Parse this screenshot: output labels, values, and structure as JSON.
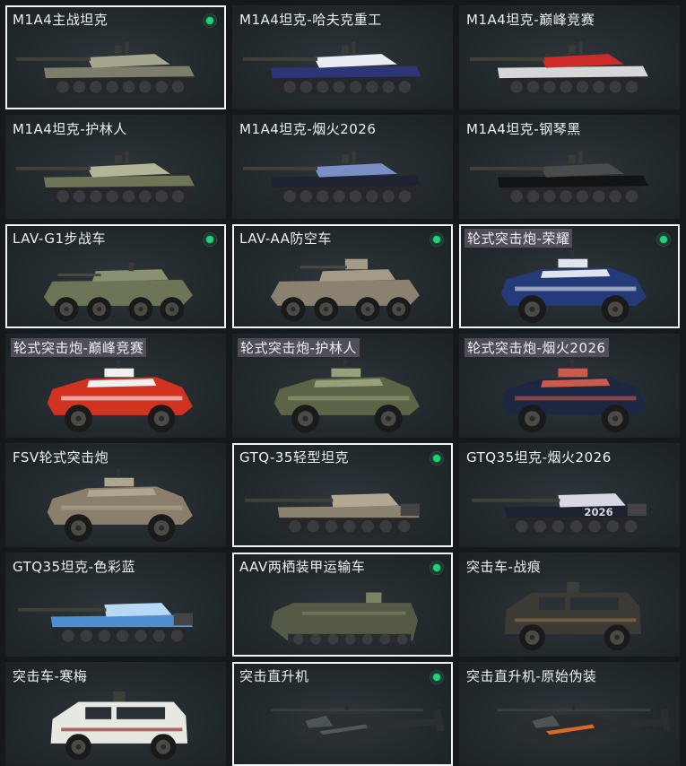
{
  "vehicles": [
    {
      "name": "M1A4主战坦克",
      "type": "tank",
      "body": "#7c7d6a",
      "accent": "#a6a58d",
      "selected": true,
      "equipped": true
    },
    {
      "name": "M1A4坦克-哈夫克重工",
      "type": "tank",
      "body": "#2d3577",
      "accent": "#e9ecf5",
      "selected": false,
      "equipped": false
    },
    {
      "name": "M1A4坦克-巅峰竞赛",
      "type": "tank",
      "body": "#d7d7d7",
      "accent": "#cf2a2a",
      "selected": false,
      "equipped": false
    },
    {
      "name": "M1A4坦克-护林人",
      "type": "tank",
      "body": "#6f7556",
      "accent": "#b3b597",
      "selected": false,
      "equipped": false
    },
    {
      "name": "M1A4坦克-烟火2026",
      "type": "tank",
      "body": "#1f2331",
      "accent": "#7b8fc6",
      "selected": false,
      "equipped": false
    },
    {
      "name": "M1A4坦克-钢琴黑",
      "type": "tank",
      "body": "#121314",
      "accent": "#4a4b4d",
      "selected": false,
      "equipped": false
    },
    {
      "name": "LAV-G1步战车",
      "type": "apc8",
      "body": "#6d7559",
      "accent": "#8b9170",
      "selected": true,
      "equipped": true
    },
    {
      "name": "LAV-AA防空车",
      "type": "apc8aa",
      "body": "#8b8170",
      "accent": "#a49a86",
      "selected": true,
      "equipped": true
    },
    {
      "name": "轮式突击炮-荣耀",
      "type": "wheeled",
      "body": "#243a79",
      "accent": "#dfe4ee",
      "selected": true,
      "equipped": true,
      "highlight": true
    },
    {
      "name": "轮式突击炮-巅峰竞赛",
      "type": "wheeled",
      "body": "#d23220",
      "accent": "#f1f1f1",
      "selected": false,
      "equipped": false,
      "highlight": true
    },
    {
      "name": "轮式突击炮-护林人",
      "type": "wheeled",
      "body": "#5b6447",
      "accent": "#97a07a",
      "selected": false,
      "equipped": false,
      "highlight": true
    },
    {
      "name": "轮式突击炮-烟火2026",
      "type": "wheeled",
      "body": "#1d2741",
      "accent": "#c95a4c",
      "selected": false,
      "equipped": false,
      "highlight": true
    },
    {
      "name": "FSV轮式突击炮",
      "type": "wheeled",
      "body": "#8a7f6c",
      "accent": "#b0a58f",
      "selected": false,
      "equipped": false
    },
    {
      "name": "GTQ-35轻型坦克",
      "type": "lighttank",
      "body": "#8b8370",
      "accent": "#b1a992",
      "selected": true,
      "equipped": true
    },
    {
      "name": "GTQ35坦克-烟火2026",
      "type": "lighttank",
      "body": "#1b2230",
      "accent": "#d8d8e4",
      "selected": false,
      "equipped": false,
      "decal": "2026"
    },
    {
      "name": "GTQ35坦克-色彩蓝",
      "type": "lighttank",
      "body": "#4f8fcf",
      "accent": "#b8d9f5",
      "selected": false,
      "equipped": false
    },
    {
      "name": "AAV两栖装甲运输车",
      "type": "aav",
      "body": "#545a45",
      "accent": "#7c8266",
      "selected": true,
      "equipped": true
    },
    {
      "name": "突击车-战痕",
      "type": "mrap",
      "body": "#3c3a35",
      "accent": "#8a6a44",
      "selected": false,
      "equipped": false
    },
    {
      "name": "突击车-寒梅",
      "type": "mrap",
      "body": "#e7e7e4",
      "accent": "#8f2e2e",
      "selected": false,
      "equipped": false
    },
    {
      "name": "突击直升机",
      "type": "heli",
      "body": "#2b2f31",
      "accent": "#51585c",
      "selected": true,
      "equipped": true
    },
    {
      "name": "突击直升机-原始伪装",
      "type": "heli",
      "body": "#2b2c2d",
      "accent": "#d8692a",
      "selected": false,
      "equipped": false
    }
  ]
}
